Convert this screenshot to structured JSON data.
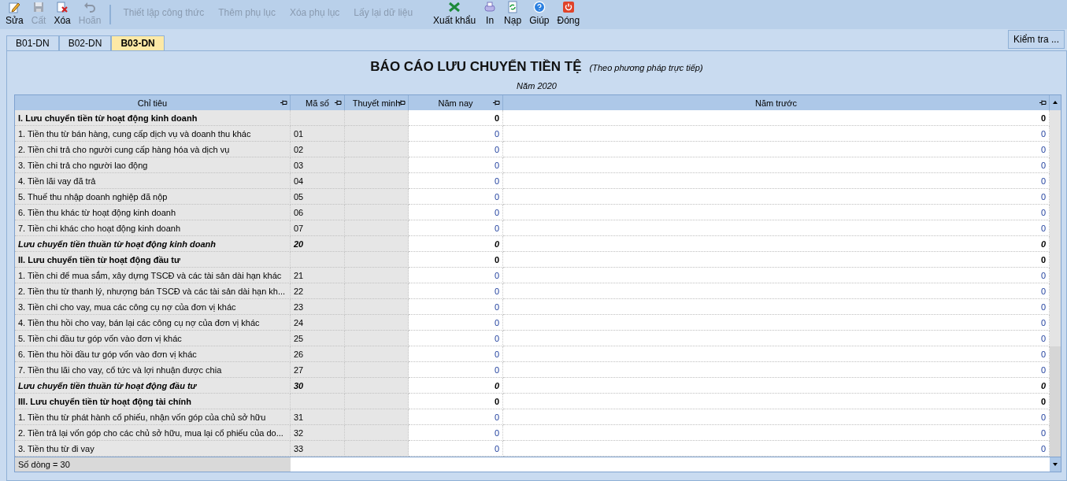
{
  "toolbar": [
    {
      "label": "Sửa",
      "kind": "icon",
      "disabled": false
    },
    {
      "label": "Cất",
      "kind": "icon",
      "disabled": true
    },
    {
      "label": "Xóa",
      "kind": "icon",
      "disabled": false
    },
    {
      "label": "Hoãn",
      "kind": "icon",
      "disabled": true
    },
    {
      "label": "Thiết lập công thức",
      "kind": "text",
      "disabled": true
    },
    {
      "label": "Thêm phụ lục",
      "kind": "text",
      "disabled": true
    },
    {
      "label": "Xóa phụ lục",
      "kind": "text",
      "disabled": true
    },
    {
      "label": "Lấy lại dữ liệu",
      "kind": "text",
      "disabled": true
    },
    {
      "label": "Xuất khẩu",
      "kind": "icon",
      "disabled": false
    },
    {
      "label": "In",
      "kind": "icon",
      "disabled": false
    },
    {
      "label": "Nạp",
      "kind": "icon",
      "disabled": false
    },
    {
      "label": "Giúp",
      "kind": "icon",
      "disabled": false
    },
    {
      "label": "Đóng",
      "kind": "icon",
      "disabled": false
    }
  ],
  "tabs": [
    {
      "label": "B01-DN",
      "selected": false
    },
    {
      "label": "B02-DN",
      "selected": false
    },
    {
      "label": "B03-DN",
      "selected": true
    }
  ],
  "check_button": "Kiểm tra ...",
  "report": {
    "title": "BÁO CÁO LƯU CHUYỂN TIỀN TỆ",
    "subtitle": "(Theo phương pháp trực tiếp)",
    "year": "Năm 2020"
  },
  "table": {
    "columns": [
      "Chỉ tiêu",
      "Mã số",
      "Thuyết minh",
      "Năm nay",
      "Năm trước"
    ],
    "rows": [
      {
        "kind": "section",
        "name": "I. Lưu chuyển tiền từ hoạt động kinh doanh",
        "code": "",
        "current": "0",
        "previous": "0"
      },
      {
        "kind": "item",
        "name": "1. Tiền thu từ bán hàng, cung cấp dịch vụ và doanh thu khác",
        "code": "01",
        "current": "0",
        "previous": "0"
      },
      {
        "kind": "item",
        "name": "2. Tiền chi trả cho người cung cấp hàng hóa và dịch vụ",
        "code": "02",
        "current": "0",
        "previous": "0"
      },
      {
        "kind": "item",
        "name": "3. Tiền chi trả cho người lao động",
        "code": "03",
        "current": "0",
        "previous": "0"
      },
      {
        "kind": "item",
        "name": "4. Tiền lãi vay đã trả",
        "code": "04",
        "current": "0",
        "previous": "0"
      },
      {
        "kind": "item",
        "name": "5. Thuế thu nhập doanh nghiệp đã nộp",
        "code": "05",
        "current": "0",
        "previous": "0"
      },
      {
        "kind": "item",
        "name": "6. Tiền thu khác từ hoạt động kinh doanh",
        "code": "06",
        "current": "0",
        "previous": "0"
      },
      {
        "kind": "item",
        "name": "7. Tiền chi khác cho hoạt động kinh doanh",
        "code": "07",
        "current": "0",
        "previous": "0"
      },
      {
        "kind": "subtotal",
        "name": "Lưu chuyển tiền thuần từ hoạt động kinh doanh",
        "code": "20",
        "current": "0",
        "previous": "0"
      },
      {
        "kind": "section",
        "name": "II. Lưu chuyển tiền từ hoạt động đầu tư",
        "code": "",
        "current": "0",
        "previous": "0"
      },
      {
        "kind": "item",
        "name": "1. Tiền chi để mua sắm, xây dựng TSCĐ và các tài sản dài hạn khác",
        "code": "21",
        "current": "0",
        "previous": "0"
      },
      {
        "kind": "item",
        "name": "2. Tiền thu từ thanh lý, nhượng bán TSCĐ và các tài sản dài hạn kh...",
        "code": "22",
        "current": "0",
        "previous": "0"
      },
      {
        "kind": "item",
        "name": "3. Tiền chi cho vay, mua các công cụ nợ của đơn vị khác",
        "code": "23",
        "current": "0",
        "previous": "0"
      },
      {
        "kind": "item",
        "name": "4. Tiền thu hồi cho vay, bán lại các công cụ nợ của đơn vị khác",
        "code": "24",
        "current": "0",
        "previous": "0"
      },
      {
        "kind": "item",
        "name": "5. Tiền chi đầu tư góp vốn vào đơn vị khác",
        "code": "25",
        "current": "0",
        "previous": "0"
      },
      {
        "kind": "item",
        "name": "6. Tiền thu hồi đầu tư góp vốn vào đơn vị khác",
        "code": "26",
        "current": "0",
        "previous": "0"
      },
      {
        "kind": "item",
        "name": "7. Tiền thu lãi cho vay, cổ tức và lợi nhuận được chia",
        "code": "27",
        "current": "0",
        "previous": "0"
      },
      {
        "kind": "subtotal",
        "name": "Lưu chuyển tiền thuần từ hoạt động đầu tư",
        "code": "30",
        "current": "0",
        "previous": "0"
      },
      {
        "kind": "section",
        "name": "III. Lưu chuyển tiền từ hoạt động tài chính",
        "code": "",
        "current": "0",
        "previous": "0"
      },
      {
        "kind": "item",
        "name": "1. Tiền thu từ phát hành cổ phiếu, nhận vốn góp của chủ sở hữu",
        "code": "31",
        "current": "0",
        "previous": "0"
      },
      {
        "kind": "item",
        "name": "2. Tiền trả lại vốn góp cho các chủ sở hữu, mua lại cổ phiếu của do...",
        "code": "32",
        "current": "0",
        "previous": "0"
      },
      {
        "kind": "item",
        "name": "3. Tiền thu từ đi vay",
        "code": "33",
        "current": "0",
        "previous": "0"
      }
    ],
    "footer": "Số dòng = 30"
  }
}
